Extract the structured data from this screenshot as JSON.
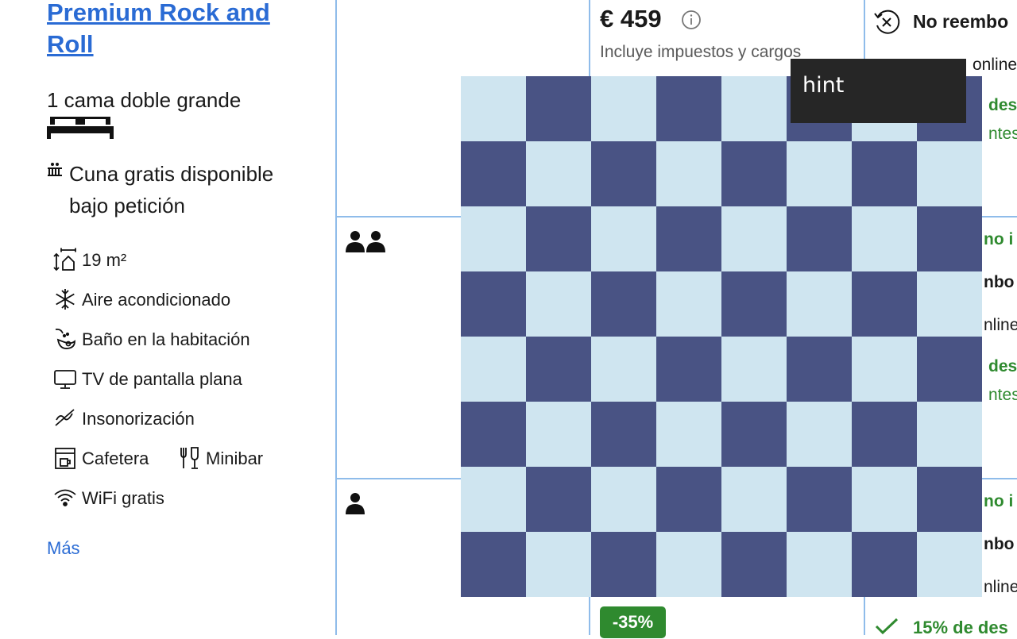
{
  "room": {
    "title": "Premium Rock and Roll",
    "bed": "1 cama doble grande",
    "crib": "Cuna gratis disponible bajo petición",
    "amenities": {
      "size": "19 m²",
      "ac": "Aire acondicionado",
      "bath": "Baño en la habitación",
      "tv": "TV de pantalla plana",
      "soundproof": "Insonorización",
      "coffee": "Cafetera",
      "minibar": "Minibar",
      "wifi": "WiFi gratis"
    },
    "more_link": "Más"
  },
  "price": {
    "amount": "€ 459",
    "taxes_note": "Incluye impuestos y cargos",
    "discount_badge": "-35%"
  },
  "policies": {
    "top_title": "No reembo",
    "top_sub": "online",
    "row1_discount": "des",
    "row1_note": "ntes",
    "row2_green": "no i",
    "row2_bold": "nbo",
    "row2_sub": "nline",
    "row2_discount": "des",
    "row2_note": "ntes",
    "row3_green": "no i",
    "row3_bold": "nbo",
    "row3_sub": "nline",
    "bottom_discount": "15% de des"
  },
  "overlay": {
    "hint": "hint"
  },
  "colors": {
    "link": "#2a6bd4",
    "green": "#2f8a2f",
    "border": "#8fbcea",
    "board_light": "#cfe5f0",
    "board_dark": "#495384",
    "hint_bg": "#262626"
  }
}
